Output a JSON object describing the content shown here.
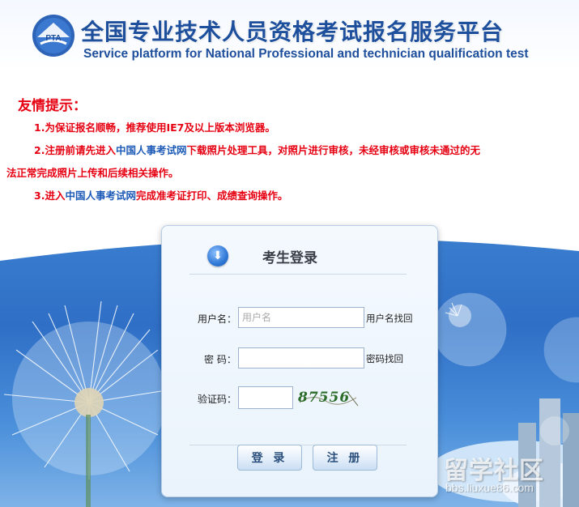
{
  "header": {
    "logo_text": "PTA",
    "title": "全国专业技术人员资格考试报名服务平台",
    "subtitle": "Service platform for National Professional and technician qualification test"
  },
  "notice": {
    "heading": "友情提示：",
    "item1": "1.为保证报名顺畅，推荐使用IE7及以上版本浏览器。",
    "item2_prefix": "2.注册前请先进入",
    "item2_link": "中国人事考试网",
    "item2_suffix": "下载照片处理工具，对照片进行审核，未经审核或审核未通过的无",
    "item2_cont": "法正常完成照片上传和后续相关操作。",
    "item3_prefix": "3.进入",
    "item3_link": "中国人事考试网",
    "item3_suffix": "完成准考证打印、成绩查询操作。"
  },
  "login": {
    "icon": "download-arrow-icon",
    "title": "考生登录",
    "username_label": "用户名：",
    "username_value": "",
    "username_placeholder": "用户名",
    "username_recover": "用户名找回",
    "password_label": "密  码：",
    "password_value": "",
    "password_recover": "密码找回",
    "captcha_label": "验证码：",
    "captcha_value": "",
    "captcha_image_text": "87556",
    "login_button": "登 录",
    "register_button": "注 册"
  },
  "watermark": {
    "cn": "留学社区",
    "en": "bbs.liuxue86.com"
  },
  "colors": {
    "brand_blue": "#1d4f9c",
    "notice_red": "#e60012",
    "link_blue": "#1d5ab7",
    "sky_blue": "#2f6fc6"
  }
}
